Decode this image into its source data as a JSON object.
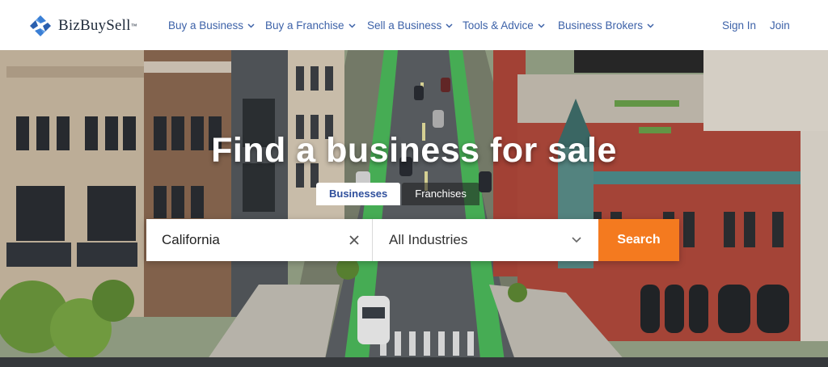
{
  "brand": {
    "name": "BizBuySell",
    "trademark": "™"
  },
  "nav": {
    "items": [
      {
        "label": "Buy a Business"
      },
      {
        "label": "Buy a Franchise"
      },
      {
        "label": "Sell a Business"
      },
      {
        "label": "Tools & Advice"
      },
      {
        "label": "Business Brokers"
      }
    ],
    "sign_in": "Sign In",
    "join": "Join"
  },
  "hero": {
    "title": "Find a business for sale",
    "tabs": [
      {
        "label": "Businesses",
        "active": true
      },
      {
        "label": "Franchises",
        "active": false
      }
    ],
    "search": {
      "location_value": "California",
      "industry_value": "All Industries",
      "button_label": "Search"
    }
  },
  "colors": {
    "nav_link": "#3d62a8",
    "brand_blue": "#2f6fbf",
    "search_button": "#f47a1f"
  }
}
